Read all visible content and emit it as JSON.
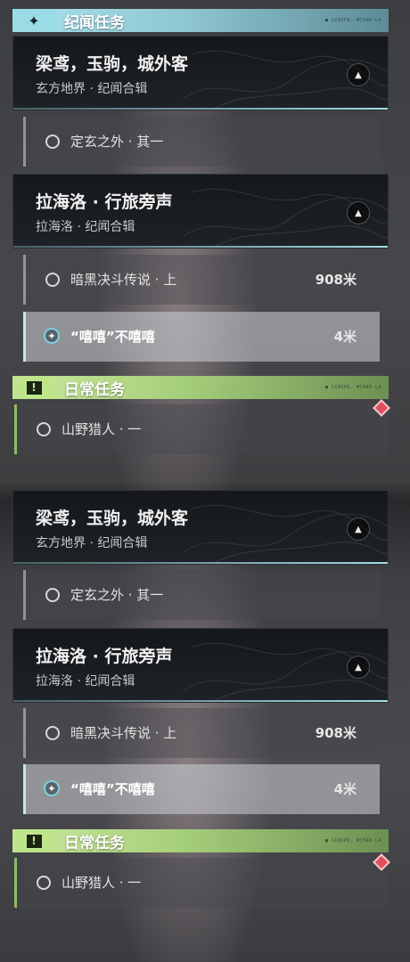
{
  "panels": [
    {
      "story_header": {
        "label": "纪闻任务",
        "icon": "sparkle-icon",
        "deco": "■ GINSPR. #CHAR-LA"
      },
      "quest_groups": [
        {
          "title": "梁鸢，玉驹，城外客",
          "subtitle": "玄方地界 · 纪闻合辑",
          "toggle_icon": "arrow-up-icon",
          "steps": [
            {
              "text": "定玄之外 · 其一",
              "distance": "",
              "tracked": false
            }
          ]
        },
        {
          "title": "拉海洛 · 行旅旁声",
          "subtitle": "拉海洛 · 纪闻合辑",
          "toggle_icon": "arrow-up-icon",
          "steps": [
            {
              "text": "暗黑决斗传说 · 上",
              "distance": "908米",
              "tracked": false
            },
            {
              "text": "“嘻嘻”不嘻嘻",
              "distance": "4米",
              "tracked": true
            }
          ]
        }
      ],
      "daily_header": {
        "label": "日常任务",
        "icon": "exclamation-box-icon",
        "icon_glyph": "!",
        "deco": "■ GINSPR. #CHAR-LA"
      },
      "daily_steps": [
        {
          "text": "山野猎人 · 一",
          "marker_icon": "red-diamond-icon"
        }
      ]
    },
    {
      "quest_groups": [
        {
          "title": "梁鸢，玉驹，城外客",
          "subtitle": "玄方地界 · 纪闻合辑",
          "toggle_icon": "arrow-up-icon",
          "steps": [
            {
              "text": "定玄之外 · 其一",
              "distance": "",
              "tracked": false
            }
          ]
        },
        {
          "title": "拉海洛 · 行旅旁声",
          "subtitle": "拉海洛 · 纪闻合辑",
          "toggle_icon": "arrow-up-icon",
          "steps": [
            {
              "text": "暗黑决斗传说 · 上",
              "distance": "908米",
              "tracked": false
            },
            {
              "text": "“嘻嘻”不嘻嘻",
              "distance": "4米",
              "tracked": true
            }
          ]
        }
      ],
      "daily_header": {
        "label": "日常任务",
        "icon": "exclamation-box-icon",
        "icon_glyph": "!",
        "deco": "■ GINSPR. #CHAR-LA"
      },
      "daily_steps": [
        {
          "text": "山野猎人 · 一",
          "marker_icon": "red-diamond-icon"
        }
      ]
    }
  ],
  "colors": {
    "story_accent": "#a9e3ec",
    "daily_accent": "#bfe58c",
    "marker_red": "#e0505e"
  }
}
